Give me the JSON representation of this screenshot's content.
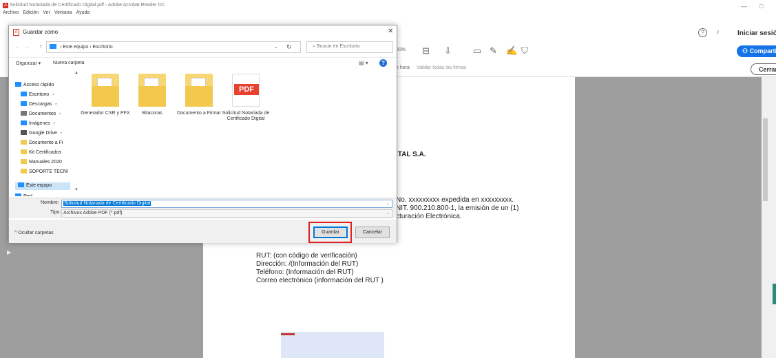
{
  "window": {
    "title": "Solicitud Notariada de Certificado Digital.pdf - Adobe Acrobat Reader DC",
    "menu": [
      "Archivo",
      "Edición",
      "Ver",
      "Ventana",
      "Ayuda"
    ],
    "minimize": "—",
    "restore": "□"
  },
  "acrobat": {
    "login": "Iniciar sesió",
    "zoom": "00%",
    "share": "Comparti",
    "sig_label_1": "e hora",
    "sig_label_2": "Validar todas las firmas",
    "close": "Cerrar"
  },
  "document": {
    "company": "ITAL S.A.",
    "para": [
      "No. xxxxxxxxx expedida en xxxxxxxxx.",
      "NIT. 900.210.800-1, la emisión de un (1)",
      "cturación Electrónica."
    ],
    "info": [
      "RUT: (con código de verificación)",
      "Dirección: /(Información del RUT)",
      "Teléfono: (Información del RUT)",
      "Correo electrónico (información del RUT )"
    ]
  },
  "dialog": {
    "title": "Guardar como",
    "path": [
      "Este equipo",
      "Escritorio"
    ],
    "search_placeholder": "Buscar en Escritorio",
    "organize": "Organizar ▾",
    "new_folder": "Nueva carpeta",
    "nav": [
      {
        "label": "Acceso rápido",
        "icon": "star-icon",
        "color": "#1e90ff"
      },
      {
        "label": "Escritorio",
        "icon": "desktop-icon",
        "color": "#1e90ff"
      },
      {
        "label": "Descargas",
        "icon": "download-icon",
        "color": "#1e90ff"
      },
      {
        "label": "Documentos",
        "icon": "documents-icon",
        "color": "#777777"
      },
      {
        "label": "Imágenes",
        "icon": "images-icon",
        "color": "#1e90ff"
      },
      {
        "label": "Google Drive",
        "icon": "drive-icon",
        "color": "#555555"
      },
      {
        "label": "Documento a Fi",
        "icon": "folder-icon",
        "color": "#f2c94c"
      },
      {
        "label": "Kit Certificados",
        "icon": "folder-icon",
        "color": "#f2c94c"
      },
      {
        "label": "Manuales 2020",
        "icon": "folder-icon",
        "color": "#f2c94c"
      },
      {
        "label": "SOPORTE TECNI",
        "icon": "folder-icon",
        "color": "#f2c94c"
      },
      {
        "label": "Este equipo",
        "icon": "computer-icon",
        "color": "#1e90ff"
      },
      {
        "label": "Red",
        "icon": "network-icon",
        "color": "#1e90ff"
      }
    ],
    "files": [
      {
        "name": "Generador CSR y PFX",
        "type": "folder"
      },
      {
        "name": "Bitacoras",
        "type": "folder"
      },
      {
        "name": "Documento a Firmar",
        "type": "folder"
      },
      {
        "name": "Solicitud Notariada de Certificado Digital",
        "type": "pdf"
      }
    ],
    "name_label": "Nombre:",
    "name_value": "Solicitud Notariada de Certificado Digital",
    "type_label": "Tipo:",
    "type_value": "Archivos Adobe PDF (*.pdf)",
    "hide_folders": "Ocultar carpetas",
    "save": "Guardar",
    "cancel": "Cancelar",
    "pdf_badge": "PDF"
  }
}
